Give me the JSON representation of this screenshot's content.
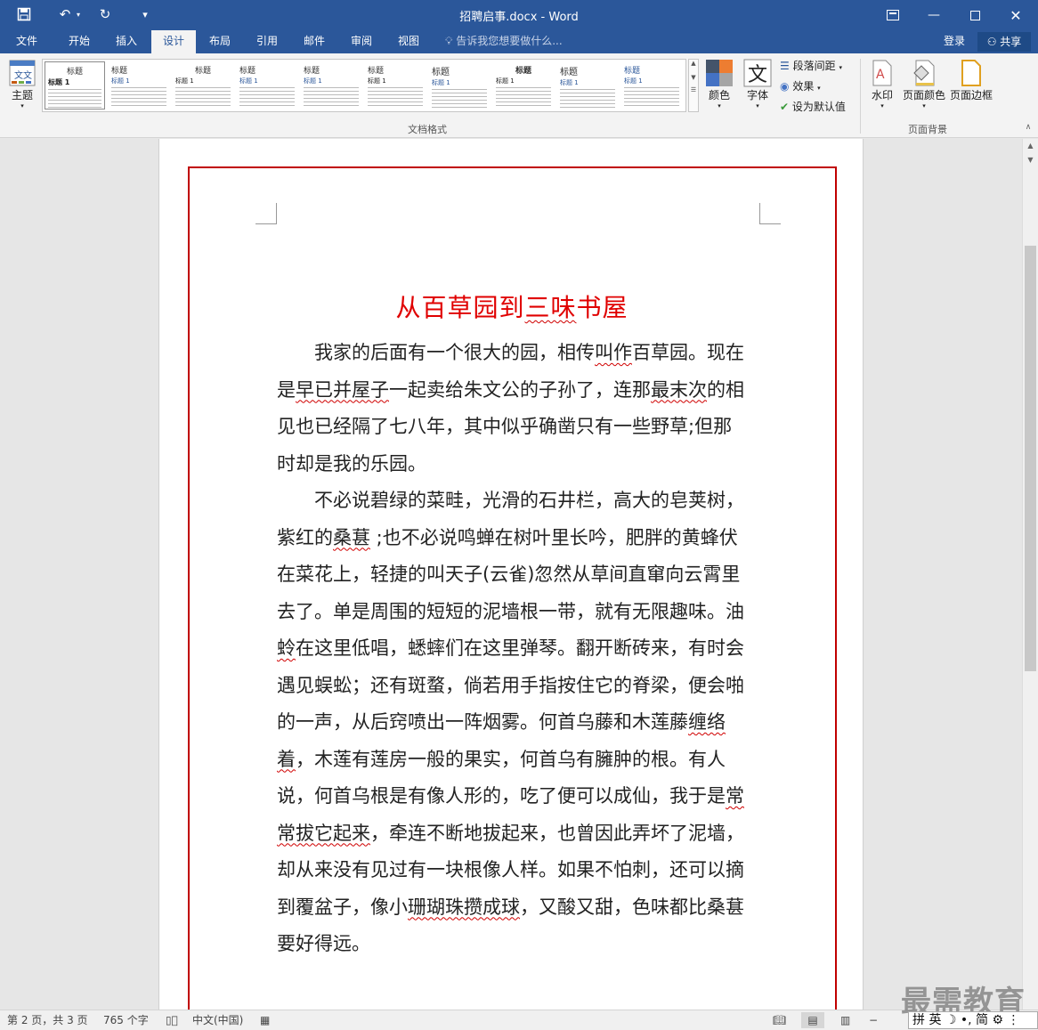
{
  "window": {
    "title": "招聘启事.docx - Word",
    "accent": "#2b579a"
  },
  "quick_access": [
    "save-icon",
    "undo-icon",
    "redo-icon",
    "customize-icon"
  ],
  "tabs": [
    {
      "label": "文件"
    },
    {
      "label": "开始"
    },
    {
      "label": "插入"
    },
    {
      "label": "设计"
    },
    {
      "label": "布局"
    },
    {
      "label": "引用"
    },
    {
      "label": "邮件"
    },
    {
      "label": "审阅"
    },
    {
      "label": "视图"
    }
  ],
  "active_tab": "设计",
  "tell_me": "告诉我您想要做什么...",
  "account": {
    "login": "登录",
    "share": "共享"
  },
  "ribbon": {
    "theme_label": "主题",
    "gallery": [
      {
        "h1": "标题",
        "h2": "标题 1"
      },
      {
        "h1": "标题",
        "h2": "标题 1"
      },
      {
        "h1": "标题",
        "h2": "标题 1"
      },
      {
        "h1": "标题",
        "h2": "标题 1"
      },
      {
        "h1": "标题",
        "h2": "标题 1"
      },
      {
        "h1": "标题",
        "h2": "标题 1"
      },
      {
        "h1": "标题",
        "h2": "标题 1"
      },
      {
        "h1": "标题",
        "h2": "标题 1"
      },
      {
        "h1": "标题",
        "h2": "标题 1"
      },
      {
        "h1": "标题",
        "h2": "标题 1"
      }
    ],
    "doc_format_group": "文档格式",
    "colors_label": "颜色",
    "fonts_label": "字体",
    "paragraph_spacing": "段落间距",
    "effects": "效果",
    "set_default": "设为默认值",
    "watermark": "水印",
    "page_color": "页面颜色",
    "page_borders": "页面边框",
    "page_background_group": "页面背景"
  },
  "document": {
    "title": "从百草园到三味书屋",
    "title_color": "#e00000",
    "border_color": "#c00000",
    "paragraphs": [
      {
        "segments": [
          {
            "t": "我家的后面有一个很大的园，相传"
          },
          {
            "t": "叫作",
            "squig": true
          },
          {
            "t": "百草园。现在是"
          },
          {
            "t": "早已并屋子",
            "squig": true
          },
          {
            "t": "一起卖给朱文公的子孙了，连那"
          },
          {
            "t": "最末次",
            "squig": true
          },
          {
            "t": "的相见也已经隔了七八年，其中似乎确凿只有一些野草;但那时却是我的乐园。"
          }
        ]
      },
      {
        "segments": [
          {
            "t": "不必说碧绿的菜畦，光滑的石井栏，高大的皂荚树，紫红的"
          },
          {
            "t": "桑葚",
            "squig": true
          },
          {
            "t": "  ;也不必说鸣蝉在树叶里长吟，肥胖的黄蜂伏在菜花上，轻捷的叫天子(云雀)忽然从草间直窜向云霄里去了。单是周围的短短的泥墙根一带，就有无限趣味。油"
          },
          {
            "t": "蛉",
            "squig": true
          },
          {
            "t": "在这里低唱，蟋蟀们在这里弹琴。翻开断砖来，有时会遇见蜈蚣；还有斑蝥，倘若用手指按住它的脊梁，便会啪的一声，从后窍喷出一阵烟雾。何首乌藤和木莲藤"
          },
          {
            "t": "缠络着",
            "squig": true
          },
          {
            "t": "，木莲有莲房一般的果实，何首乌有臃肿的根。有人说，何首乌根是有像人形的，吃了便可以成仙，我于是"
          },
          {
            "t": "常常拔它起来",
            "squig": true
          },
          {
            "t": "，牵连不断地拔起来，也曾因此弄坏了泥墙，却从来没有见过有一块根像人样。如果不怕刺，还可以摘到覆盆子，像小"
          },
          {
            "t": "珊瑚珠攒成",
            "squig": true
          },
          {
            "t": ""
          },
          {
            "t": "球",
            "squig": true
          },
          {
            "t": "，又酸又甜，色味都比桑葚要好得远。"
          }
        ]
      }
    ]
  },
  "status": {
    "page": "第 2 页，共 3 页",
    "words": "765 个字",
    "language": "中文(中国)"
  },
  "overlay": {
    "watermark_text": "最需教育",
    "ime_text": "拼 英 ☽ •, 简 ⚙ ⋮"
  }
}
